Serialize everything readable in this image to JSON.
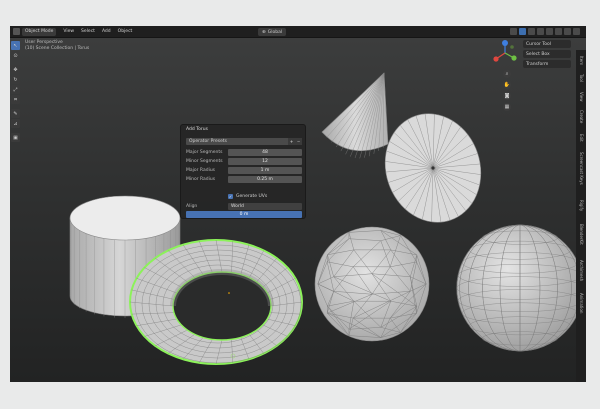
{
  "header": {
    "mode": "Object Mode",
    "menu": [
      "View",
      "Select",
      "Add",
      "Object"
    ],
    "transform_orientation": "Global"
  },
  "viewport": {
    "view_name": "User Perspective",
    "collection_info": "(10) Scene Collection | Torus"
  },
  "npanel": {
    "rows": [
      "Cursor Tool",
      "Select Box",
      "Transform"
    ]
  },
  "side_tabs": [
    "Item",
    "Tool",
    "View",
    "Create",
    "Edit",
    "Screencast Keys",
    "Rigify",
    "BlenderKit",
    "Archimesh",
    "Animation"
  ],
  "redo_panel": {
    "title": "Add Torus",
    "fill_type_label": "Operator Presets",
    "properties": [
      {
        "label": "Major Segments",
        "value": "48"
      },
      {
        "label": "Minor Segments",
        "value": "12"
      },
      {
        "label": "Major Radius",
        "value": "1 m"
      },
      {
        "label": "Minor Radius",
        "value": "0.25 m"
      }
    ],
    "generate_uvs_label": "Generate UVs",
    "generate_uvs": true,
    "align_label": "Align",
    "align_value": "World",
    "location_value": "0 m"
  },
  "colors": {
    "accent": "#4772b3",
    "selection_outline": "#7ee04a",
    "mesh": "#cfcfcf",
    "gizmo_x": "#e0473f",
    "gizmo_y": "#6ec044",
    "gizmo_z": "#3f7fe0"
  }
}
